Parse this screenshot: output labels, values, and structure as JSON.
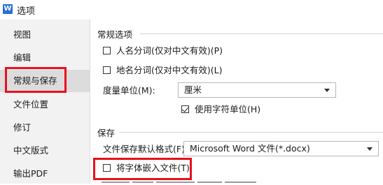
{
  "window": {
    "title": "选项",
    "app_icon": "W"
  },
  "sidebar": {
    "items": [
      {
        "label": "视图"
      },
      {
        "label": "编辑"
      },
      {
        "label": "常规与保存"
      },
      {
        "label": "文件位置"
      },
      {
        "label": "修订"
      },
      {
        "label": "中文版式"
      },
      {
        "label": "输出PDF"
      }
    ],
    "active_index": 2
  },
  "general": {
    "title": "常规选项",
    "person_name": {
      "label": "人名分词(仅对中文有效)(P)",
      "checked": false
    },
    "place_name": {
      "label": "地名分词(仅对中文有效)(L)",
      "checked": false
    },
    "unit": {
      "label": "度量单位(M):",
      "value": "厘米"
    },
    "char_unit": {
      "label": "使用字符单位(H)",
      "checked": true
    }
  },
  "save": {
    "title": "保存",
    "format": {
      "label": "文件保存默认格式(F):",
      "value": "Microsoft Word 文件(*.docx)"
    },
    "embed_fonts": {
      "label": "将字体嵌入文件(T)",
      "checked": false
    }
  },
  "colors": {
    "highlight": "#e8101d",
    "active_bg": "#dcdcdc",
    "sidebar_bg": "#f2f2f2"
  }
}
